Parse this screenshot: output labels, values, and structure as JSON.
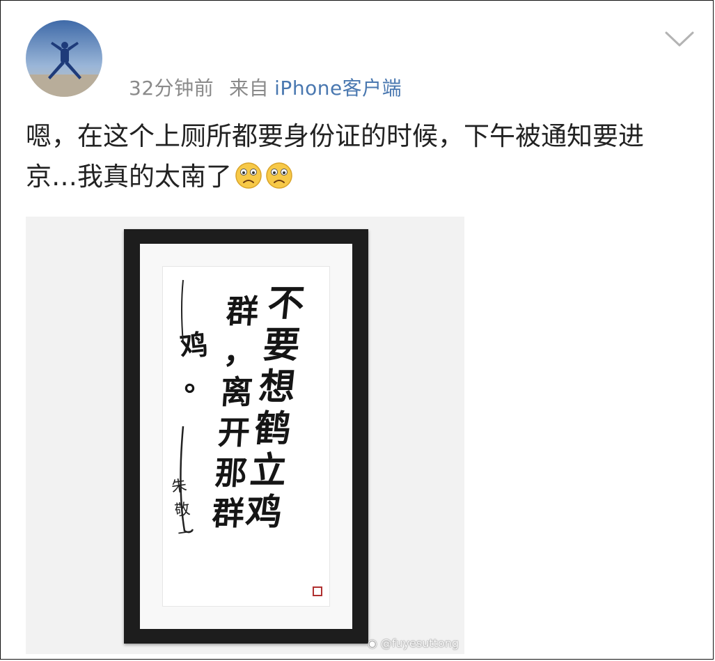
{
  "post": {
    "author_avatar_icon": "avatar-jumping-person",
    "time": "32分钟前",
    "source_label": "来自",
    "source_name": "iPhone客户端",
    "more_icon": "chevron-down-icon",
    "text": "嗯，在这个上厕所都要身份证的时候，下午被通知要进京…我真的太南了",
    "emoji": [
      "sad-face-icon",
      "sad-face-icon"
    ]
  },
  "image": {
    "calligraphy_columns": [
      "不要想鹤立鸡",
      "群，离开那群",
      "鸡。"
    ],
    "signature": "朱敬一",
    "watermark": "@fuyesuttong",
    "colors": {
      "frame": "#1d1d1d",
      "background": "#f2f2f2",
      "seal": "#b03030"
    }
  },
  "colors": {
    "meta_text": "#8a8a8a",
    "link": "#4a78b0",
    "body_text": "#222222"
  }
}
